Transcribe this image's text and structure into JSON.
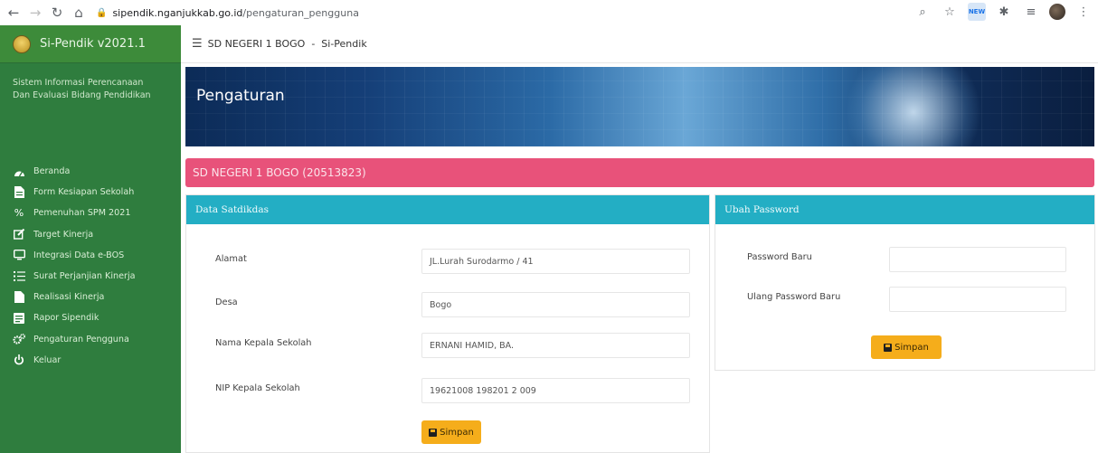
{
  "browser": {
    "back_icon": "back-arrow-icon",
    "forward_icon": "forward-arrow-icon",
    "reload_icon": "reload-icon",
    "home_icon": "home-icon",
    "url_domain": "sipendik.nganjukkab.go.id",
    "url_path": "/pengaturan_pengguna"
  },
  "sidebar": {
    "brand": "Si-Pendik v2021.1",
    "tagline_line1": "Sistem Informasi Perencanaan",
    "tagline_line2": "Dan Evaluasi Bidang Pendidikan",
    "items": [
      {
        "label": "Beranda",
        "icon": "dashboard-icon"
      },
      {
        "label": "Form Kesiapan Sekolah",
        "icon": "document-icon"
      },
      {
        "label": "Pemenuhan SPM 2021",
        "icon": "percent-icon"
      },
      {
        "label": "Target Kinerja",
        "icon": "edit-icon"
      },
      {
        "label": "Integrasi Data e-BOS",
        "icon": "monitor-icon"
      },
      {
        "label": "Surat Perjanjian Kinerja",
        "icon": "list-icon"
      },
      {
        "label": "Realisasi Kinerja",
        "icon": "file-icon"
      },
      {
        "label": "Rapor Sipendik",
        "icon": "report-icon"
      },
      {
        "label": "Pengaturan Pengguna",
        "icon": "gears-icon"
      },
      {
        "label": "Keluar",
        "icon": "power-icon"
      }
    ]
  },
  "topbar": {
    "title": "SD NEGERI 1 BOGO  -  Si-Pendik"
  },
  "banner": {
    "title": "Pengaturan"
  },
  "school": {
    "title": "SD NEGERI 1 BOGO (20513823)"
  },
  "satdikdas": {
    "header": "Data Satdikdas",
    "fields": [
      {
        "label": "Alamat",
        "value": "JL.Lurah Surodarmo / 41"
      },
      {
        "label": "Desa",
        "value": "Bogo"
      },
      {
        "label": "Nama Kepala Sekolah",
        "value": "ERNANI HAMID, BA."
      },
      {
        "label": "NIP Kepala Sekolah",
        "value": "19621008 198201 2 009"
      }
    ],
    "save_label": "Simpan"
  },
  "password": {
    "header": "Ubah Password",
    "new_label": "Password Baru",
    "repeat_label": "Ulang Password Baru",
    "save_label": "Simpan"
  },
  "colors": {
    "sidebar": "#2f7d3e",
    "pink_bar": "#e8527a",
    "panel_header": "#23aec4",
    "save_button": "#f5ad1b"
  }
}
